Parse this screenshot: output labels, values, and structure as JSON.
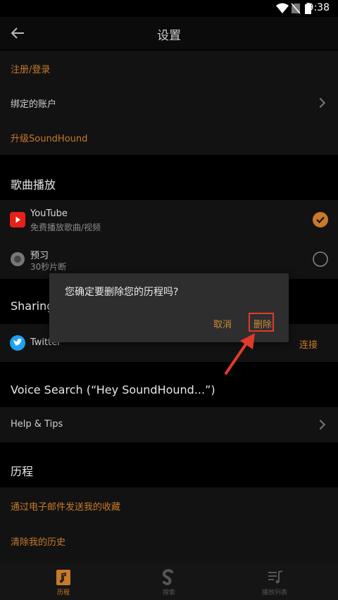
{
  "status_bar": {
    "time": "9:38"
  },
  "appbar": {
    "title": "设置"
  },
  "account": {
    "register_login": "注册/登录",
    "bound_accounts": "绑定的账户",
    "upgrade": "升级SoundHound"
  },
  "song_playback": {
    "heading": "歌曲播放",
    "youtube_name": "YouTube",
    "youtube_sub": "免费播放歌曲/视频",
    "preview_name": "预习",
    "preview_sub": "30秒片断"
  },
  "sharing": {
    "heading": "Sharing",
    "twitter": "Twitter",
    "connect": "连接"
  },
  "voice_search": {
    "heading": "Voice Search (“Hey SoundHound...”)",
    "help_tips": "Help & Tips"
  },
  "history": {
    "heading": "历程",
    "email_bookmarks": "通过电子邮件发送我的收藏",
    "clear_history": "清除我的历史"
  },
  "dialog": {
    "message": "您确定要删除您的历程吗?",
    "cancel": "取消",
    "delete": "删除"
  },
  "tabs": [
    {
      "label": "历程"
    },
    {
      "label": "搜索"
    },
    {
      "label": "播放列表"
    }
  ],
  "colors": {
    "accent": "#c87a2a",
    "highlight": "#e23a2a",
    "youtube": "#e62117",
    "twitter": "#1da1f2"
  }
}
